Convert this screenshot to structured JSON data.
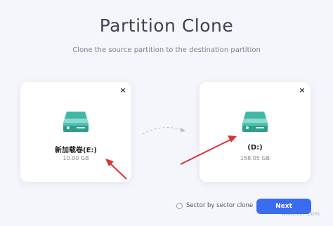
{
  "page": {
    "title": "Partition Clone",
    "subtitle": "Clone the source partition to the destination partition"
  },
  "source_card": {
    "label": "新加载卷(E:)",
    "size": "10.00 GB",
    "close_label": "×"
  },
  "destination_card": {
    "label": "(D:)",
    "size": "158.05 GB",
    "close_label": "×"
  },
  "options": {
    "sector_by_sector_label": "Sector by sector clone",
    "sector_by_sector_checked": false
  },
  "buttons": {
    "next_label": "Next"
  },
  "watermark": {
    "text": "www.xz7.com"
  },
  "colors": {
    "accent": "#3b6cf0",
    "drive_teal": "#3fb8a6",
    "annotation_red": "#d9323a"
  }
}
